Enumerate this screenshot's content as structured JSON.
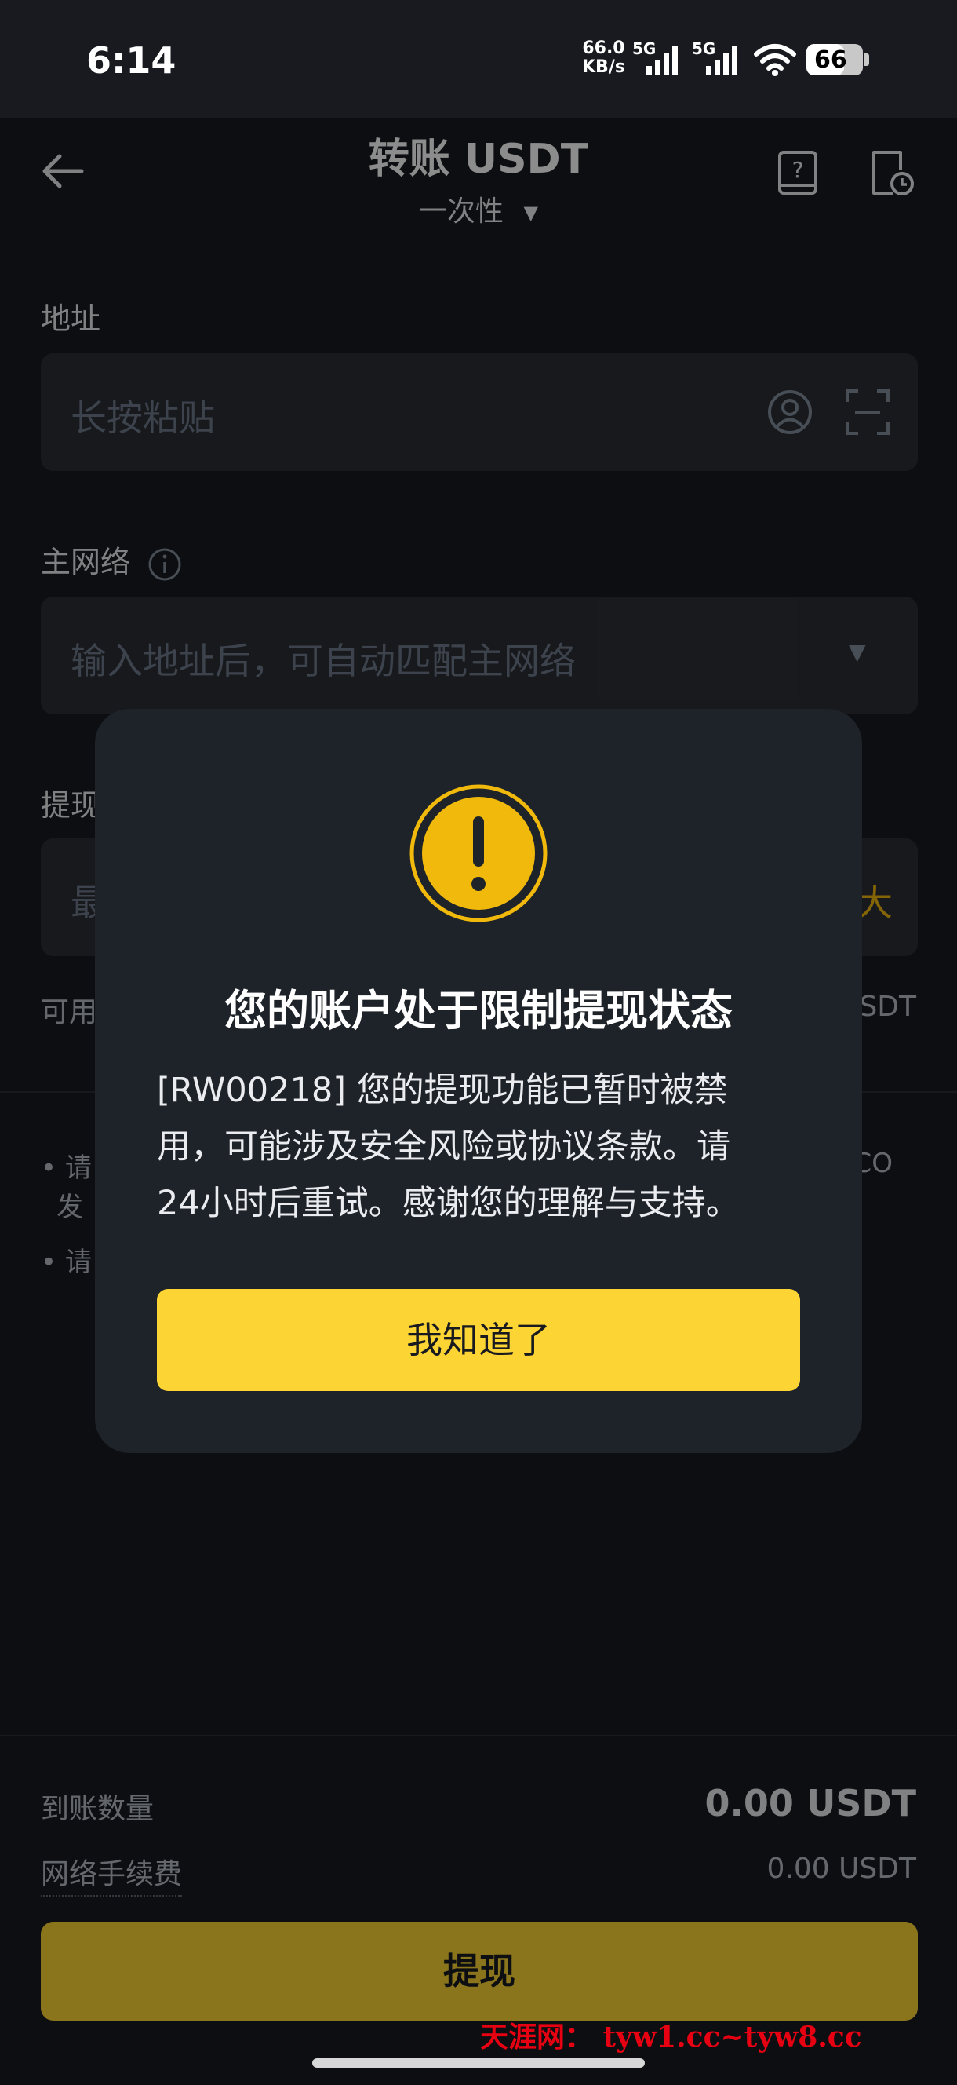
{
  "status_bar": {
    "time": "6:14",
    "speed_value": "66.0",
    "speed_unit": "KB/s",
    "signal1": "5G",
    "signal2": "5G",
    "battery": "66"
  },
  "header": {
    "title": "转账 USDT",
    "subtitle": "一次性",
    "back_icon": "arrow-left-icon",
    "help_icon": "book-help-icon",
    "history_icon": "document-clock-icon"
  },
  "form": {
    "address_label": "地址",
    "address_placeholder": "长按粘贴",
    "network_label": "主网络",
    "network_placeholder": "输入地址后，可自动匹配主网络",
    "amount_label_partial": "提现",
    "amount_placeholder_partial": "最",
    "max_partial": "大",
    "available_partial": "可用",
    "available_unit_partial": "SDT"
  },
  "notes": {
    "note1_partial": "• 请",
    "note1_line2_partial": "发",
    "note1_right_partial": "CO",
    "note2_partial": "• 请"
  },
  "summary": {
    "receive_label": "到账数量",
    "receive_value": "0.00 USDT",
    "fee_label": "网络手续费",
    "fee_value": "0.00 USDT"
  },
  "submit_label": "提现",
  "modal": {
    "title": "您的账户处于限制提现状态",
    "body_line1": "[RW00218] 您的提现功能已暂时被禁",
    "body_line2": "用，可能涉及安全风险或协议条款。请",
    "body_line3": "24小时后重试。感谢您的理解与支持。",
    "button": "我知道了"
  },
  "watermark": "天涯网： tyw1.cc~tyw8.cc",
  "colors": {
    "accent": "#fcd535",
    "background": "#181a20",
    "card": "#1e2329",
    "field": "#2b2f36",
    "warning": "#f0b90b"
  }
}
